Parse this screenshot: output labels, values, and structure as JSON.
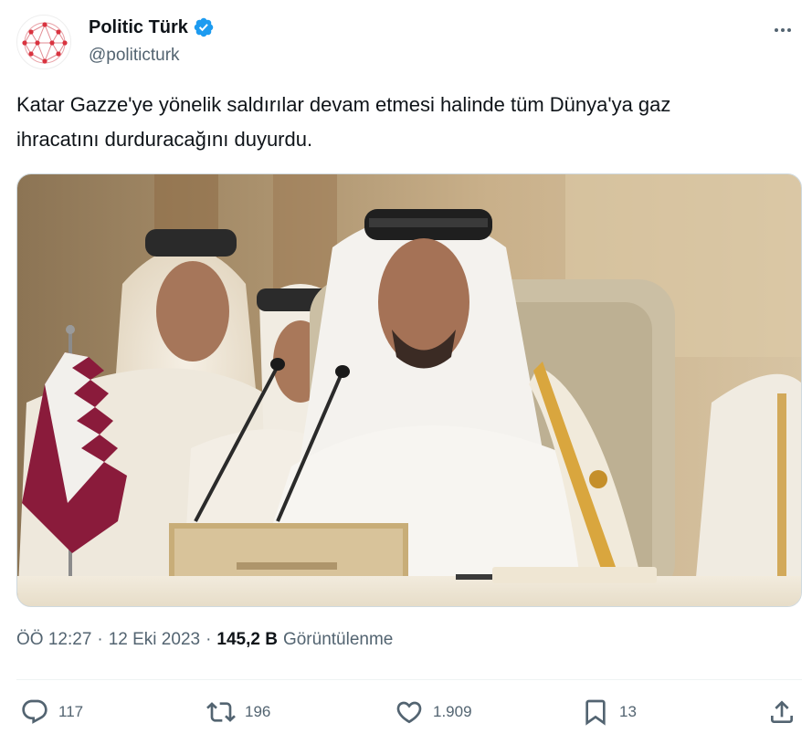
{
  "account": {
    "name": "Politic Türk",
    "handle": "@politicturk",
    "verified": true
  },
  "tweet": {
    "text_line1": "Katar Gazze'ye yönelik saldırılar devam etmesi halinde tüm Dünya'ya gaz",
    "text_line2": "ihracatını durduracağını duyurdu.",
    "image_alt": "Photo",
    "time": "ÖÖ 12:27",
    "date": "12 Eki 2023",
    "separator": "·",
    "views": "145,2 B",
    "views_label": "Görüntülenme"
  },
  "actions": {
    "replies": "117",
    "retweets": "196",
    "likes": "1.909",
    "bookmarks": "13"
  },
  "icons": {
    "more": "more-icon",
    "verified": "verified-badge-icon",
    "reply": "reply-icon",
    "retweet": "retweet-icon",
    "like": "heart-icon",
    "bookmark": "bookmark-icon",
    "share": "share-icon"
  },
  "colors": {
    "verified": "#1d9bf0",
    "text": "#0f1419",
    "secondary": "#536471",
    "border": "#cfd9de",
    "divider": "#eff3f4",
    "avatar_accent": "#d9333f"
  }
}
